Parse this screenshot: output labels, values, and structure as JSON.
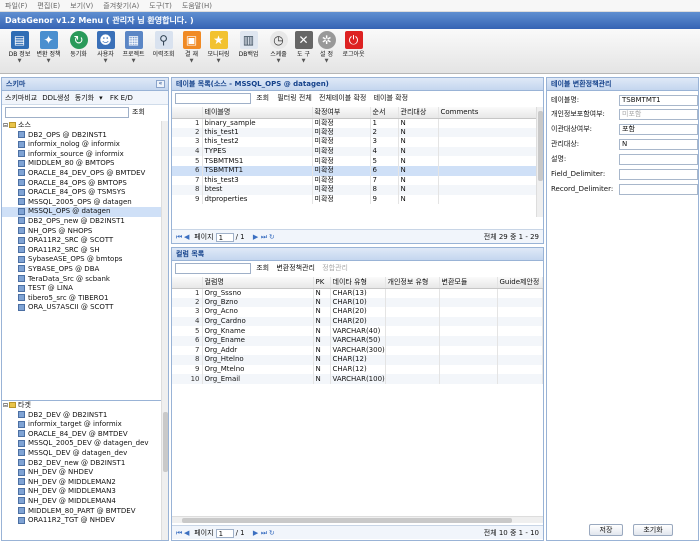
{
  "menu": [
    "파일(F)",
    "편집(E)",
    "보기(V)",
    "즐겨찾기(A)",
    "도구(T)",
    "도움말(H)"
  ],
  "title": "DataGenor v1.2 Menu ( 관리자 님 환영합니다. )",
  "toolbar": [
    "DB 정보",
    "변환 정책",
    "동기화",
    "사용자",
    "프로젝트",
    "이력조회",
    "결 재",
    "모니터링",
    "DB백업",
    "스케줄",
    "도 구",
    "설 정",
    "로그아웃"
  ],
  "left": {
    "title": "스키마",
    "tools": [
      "스키마비교",
      "DDL생성",
      "동기화",
      "FK E/D"
    ],
    "search_btn": "조회",
    "source_label": "소스",
    "source_items": [
      "DB2_OPS @ DB2INST1",
      "informix_nolog @ informix",
      "informix_source @ informix",
      "MIDDLEM_80 @ BMTOPS",
      "ORACLE_84_DEV_OPS @ BMTDEV",
      "ORACLE_84_OPS @ BMTOPS",
      "ORACLE_84_OPS @ TSMSYS",
      "MSSQL_2005_OPS @ datagen",
      "MSSQL_OPS @ datagen",
      "DB2_OPS_new @ DB2INST1",
      "NH_OPS @ NHOPS",
      "ORA11R2_SRC @ SCOTT",
      "ORA11R2_SRC @ SH",
      "SybaseASE_OPS @ bmtops",
      "SYBASE_OPS @ DBA",
      "TeraData_Src @ scbank",
      "TEST @ LINA",
      "tibero5_src @ TIBERO1",
      "ORA_US7ASCII @ SCOTT"
    ],
    "target_label": "타겟",
    "target_items": [
      "DB2_DEV @ DB2INST1",
      "informix_target @ informix",
      "ORACLE_84_DEV @ BMTDEV",
      "MSSQL_2005_DEV @ datagen_dev",
      "MSSQL_DEV @ datagen_dev",
      "DB2_DEV_new @ DB2INST1",
      "NH_DEV @ NHDEV",
      "NH_DEV @ MIDDLEMAN2",
      "NH_DEV @ MIDDLEMAN3",
      "NH_DEV @ MIDDLEMAN4",
      "MIDDLEM_80_PART @ BMTDEV",
      "ORA11R2_TGT @ NHDEV"
    ]
  },
  "tables": {
    "title": "테이블 목록(소스 - MSSQL_OPS @ datagen)",
    "tools": [
      "조회",
      "필터링 전체",
      "전체테이블 확정",
      "테이블 확정"
    ],
    "headers": [
      "테이블명",
      "확정여부",
      "순서",
      "관리대상",
      "Comments"
    ],
    "rows": [
      [
        "1",
        "binary_sample",
        "미확정",
        "1",
        "N"
      ],
      [
        "2",
        "this_test1",
        "미확정",
        "2",
        "N"
      ],
      [
        "3",
        "this_test2",
        "미확정",
        "3",
        "N"
      ],
      [
        "4",
        "TYPES",
        "미확정",
        "4",
        "N"
      ],
      [
        "5",
        "TSBMTMS1",
        "미확정",
        "5",
        "N"
      ],
      [
        "6",
        "TSBMTMT1",
        "미확정",
        "6",
        "N"
      ],
      [
        "7",
        "this_test3",
        "미확정",
        "7",
        "N"
      ],
      [
        "8",
        "btest",
        "미확정",
        "8",
        "N"
      ],
      [
        "9",
        "dtproperties",
        "미확정",
        "9",
        "N"
      ]
    ],
    "page_label": "페이지",
    "page_value": "1",
    "page_total": "/ 1",
    "info": "전체 29 중 1 - 29"
  },
  "columns": {
    "title": "컬럼 목록",
    "tools": [
      "조회",
      "변환정책관리",
      "정합관리"
    ],
    "headers": [
      "컬럼명",
      "PK",
      "데이타 유형",
      "개인정보 유형",
      "변환모듈",
      "Guide제안정"
    ],
    "rows": [
      [
        "1",
        "Org_Sssno",
        "N",
        "CHAR(13)"
      ],
      [
        "2",
        "Org_Bzno",
        "N",
        "CHAR(10)"
      ],
      [
        "3",
        "Org_Acno",
        "N",
        "CHAR(20)"
      ],
      [
        "4",
        "Org_Cardno",
        "N",
        "CHAR(20)"
      ],
      [
        "5",
        "Org_Kname",
        "N",
        "VARCHAR(40)"
      ],
      [
        "6",
        "Org_Ename",
        "N",
        "VARCHAR(50)"
      ],
      [
        "7",
        "Org_Addr",
        "N",
        "VARCHAR(300)"
      ],
      [
        "8",
        "Org_Htelno",
        "N",
        "CHAR(12)"
      ],
      [
        "9",
        "Org_Mtelno",
        "N",
        "CHAR(12)"
      ],
      [
        "10",
        "Org_Email",
        "N",
        "VARCHAR(100)"
      ]
    ],
    "page_label": "페이지",
    "page_value": "1",
    "page_total": "/ 1",
    "info": "전체 10 중 1 - 10"
  },
  "policy": {
    "title": "테이블 변환정책관리",
    "fields": [
      {
        "label": "테이블명:",
        "value": "TSBMTMT1",
        "placeholder": ""
      },
      {
        "label": "개인정보포함여부:",
        "value": "",
        "placeholder": "미포함"
      },
      {
        "label": "이관대상여부:",
        "value": "포함",
        "placeholder": ""
      },
      {
        "label": "관리대상:",
        "value": "N",
        "placeholder": ""
      },
      {
        "label": "설명:",
        "value": "",
        "placeholder": ""
      },
      {
        "label": "Field_Delimiter:",
        "value": "",
        "placeholder": ""
      },
      {
        "label": "Record_Delimiter:",
        "value": "",
        "placeholder": ""
      }
    ],
    "save": "저장",
    "reset": "초기화"
  },
  "colors": {
    "accent": "#3563b4",
    "panel_header": "#15428b",
    "selection": "#cfe0f7"
  }
}
